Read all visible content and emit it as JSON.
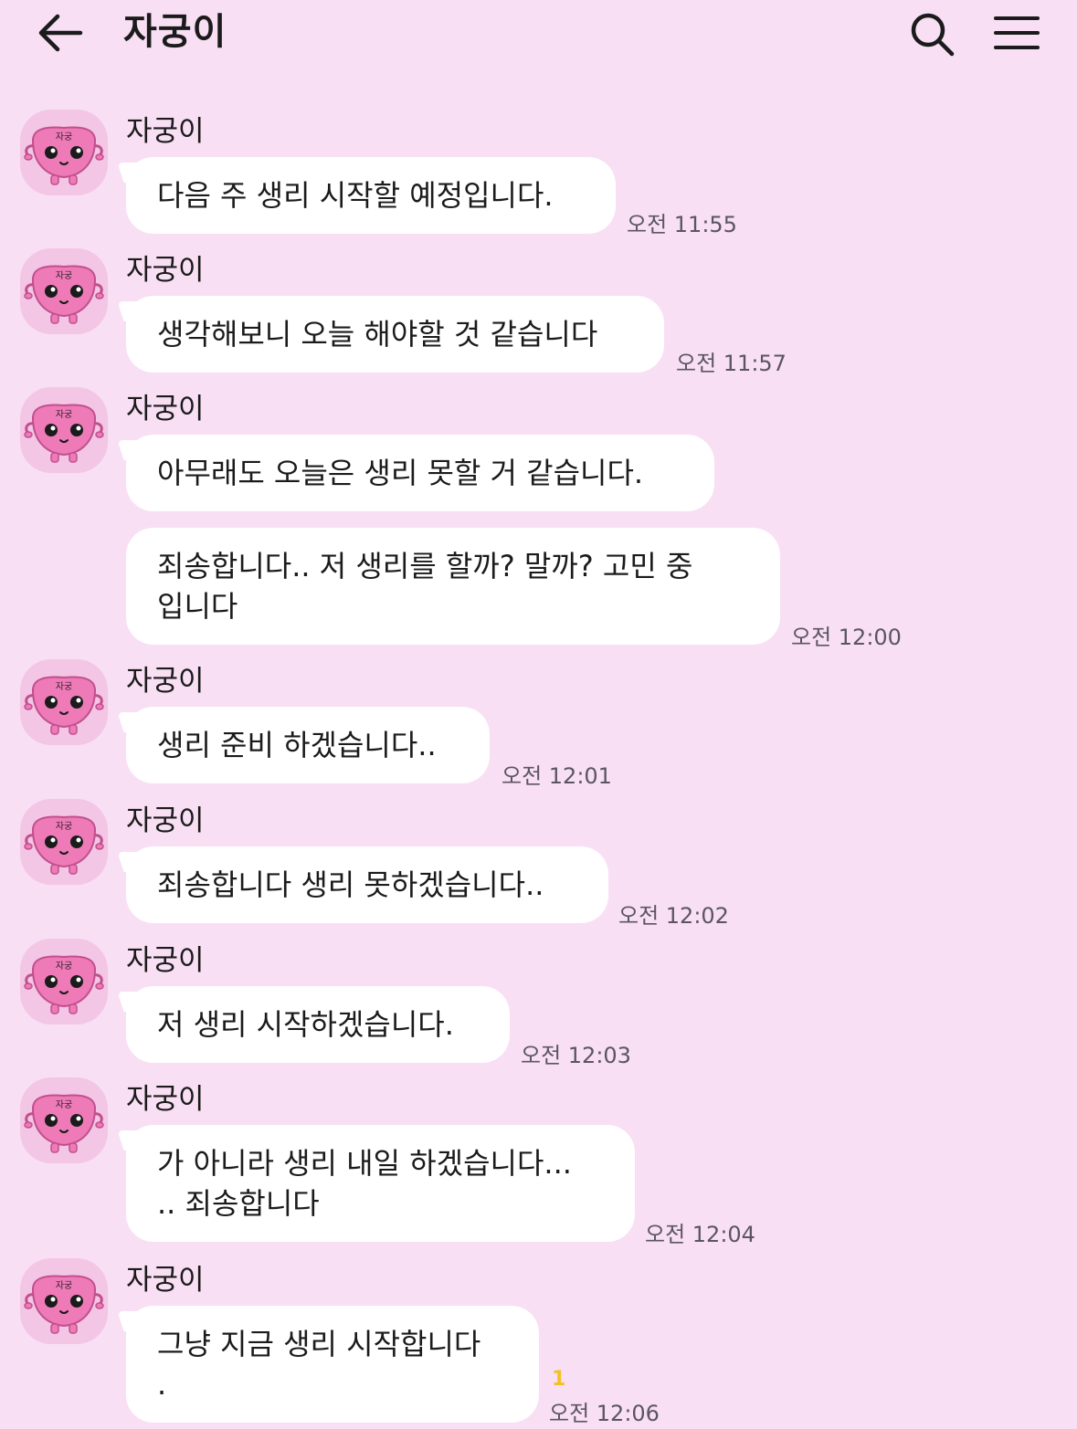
{
  "header": {
    "title": "자궁이",
    "icons": [
      "back-arrow-icon",
      "search-icon",
      "menu-icon"
    ]
  },
  "messages": [
    {
      "sender": "자궁이",
      "text": "다음 주 생리 시작할 예정입니다.",
      "time": "오전 11:55"
    },
    {
      "sender": "자궁이",
      "text": "생각해보니 오늘 해야할 것 같습니다",
      "time": "오전 11:57"
    },
    {
      "sender": "자궁이",
      "text": "아무래도 오늘은 생리 못할 거 같습니다."
    },
    {
      "line1": "죄송합니다.. 저 생리를 할까? 말까? 고민 중",
      "line2": "입니다",
      "time": "오전 12:00"
    },
    {
      "sender": "자궁이",
      "text": "생리 준비 하겠습니다..",
      "time": "오전 12:01"
    },
    {
      "sender": "자궁이",
      "text": "죄송합니다 생리 못하겠습니다..",
      "time": "오전 12:02"
    },
    {
      "sender": "자궁이",
      "text": "저 생리 시작하겠습니다.",
      "time": "오전 12:03"
    },
    {
      "sender": "자궁이",
      "line1": "가 아니라 생리 내일 하겠습니다...",
      "line2": ".. 죄송합니다",
      "time": "오전 12:04"
    },
    {
      "sender": "자궁이",
      "line1": "그냥 지금 생리 시작합니다",
      "line2": ".",
      "time": "오전 12:06",
      "unread": "1"
    }
  ],
  "colors": {
    "background": "#f8dff4",
    "bubble": "#ffffff",
    "avatar_pink": "#ee7bb7",
    "unread": "#f2c224"
  },
  "avatar": {
    "label": "자궁"
  }
}
